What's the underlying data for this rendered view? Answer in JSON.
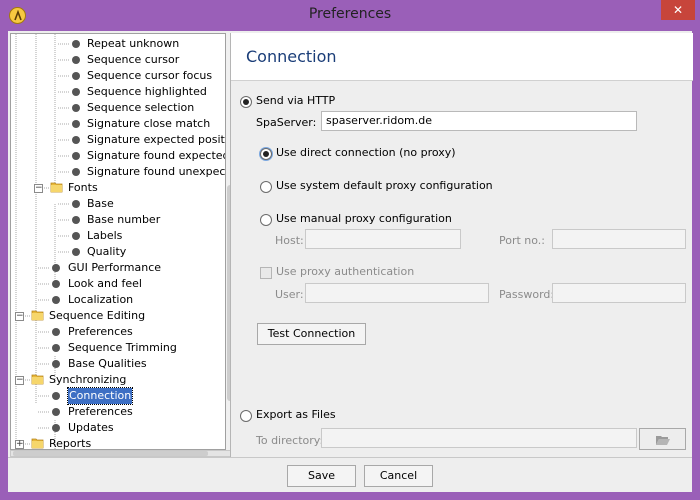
{
  "window": {
    "title": "Preferences",
    "close_glyph": "✕"
  },
  "tree": {
    "items": [
      {
        "label": "Repeat unknown",
        "level": 3,
        "kind": "leaf"
      },
      {
        "label": "Sequence cursor",
        "level": 3,
        "kind": "leaf"
      },
      {
        "label": "Sequence cursor focus",
        "level": 3,
        "kind": "leaf"
      },
      {
        "label": "Sequence highlighted",
        "level": 3,
        "kind": "leaf"
      },
      {
        "label": "Sequence selection",
        "level": 3,
        "kind": "leaf"
      },
      {
        "label": "Signature close match",
        "level": 3,
        "kind": "leaf"
      },
      {
        "label": "Signature expected position",
        "level": 3,
        "kind": "leaf"
      },
      {
        "label": "Signature found expected",
        "level": 3,
        "kind": "leaf"
      },
      {
        "label": "Signature found unexpected",
        "level": 3,
        "kind": "leaf"
      },
      {
        "label": "Fonts",
        "level": 2,
        "kind": "folder",
        "expanded": true
      },
      {
        "label": "Base",
        "level": 3,
        "kind": "leaf"
      },
      {
        "label": "Base number",
        "level": 3,
        "kind": "leaf"
      },
      {
        "label": "Labels",
        "level": 3,
        "kind": "leaf"
      },
      {
        "label": "Quality",
        "level": 3,
        "kind": "leaf"
      },
      {
        "label": "GUI Performance",
        "level": 2,
        "kind": "leaf"
      },
      {
        "label": "Look and feel",
        "level": 2,
        "kind": "leaf"
      },
      {
        "label": "Localization",
        "level": 2,
        "kind": "leaf"
      },
      {
        "label": "Sequence Editing",
        "level": 1,
        "kind": "folder",
        "expanded": true
      },
      {
        "label": "Preferences",
        "level": 2,
        "kind": "leaf"
      },
      {
        "label": "Sequence Trimming",
        "level": 2,
        "kind": "leaf"
      },
      {
        "label": "Base Qualities",
        "level": 2,
        "kind": "leaf"
      },
      {
        "label": "Synchronizing",
        "level": 1,
        "kind": "folder",
        "expanded": true
      },
      {
        "label": "Connection",
        "level": 2,
        "kind": "leaf",
        "selected": true
      },
      {
        "label": "Preferences",
        "level": 2,
        "kind": "leaf"
      },
      {
        "label": "Updates",
        "level": 2,
        "kind": "leaf"
      },
      {
        "label": "Reports",
        "level": 1,
        "kind": "folder",
        "expanded": false
      }
    ]
  },
  "panel": {
    "title": "Connection",
    "send_http_label": "Send via HTTP",
    "spaserver_label": "SpaServer:",
    "spaserver_value": "spaserver.ridom.de",
    "direct_label": "Use direct connection (no proxy)",
    "system_proxy_label": "Use system default proxy configuration",
    "manual_proxy_label": "Use manual proxy configuration",
    "host_label": "Host:",
    "port_label": "Port no.:",
    "proxy_auth_label": "Use proxy authentication",
    "user_label": "User:",
    "password_label": "Password:",
    "test_button": "Test Connection",
    "export_label": "Export as Files",
    "to_directory_label": "To directory:"
  },
  "footer": {
    "save_button": "Save",
    "cancel_button": "Cancel"
  },
  "colors": {
    "titlebar": "#9a5fb8",
    "panel_title": "#1a3d78",
    "selection": "#3d6fc4"
  }
}
